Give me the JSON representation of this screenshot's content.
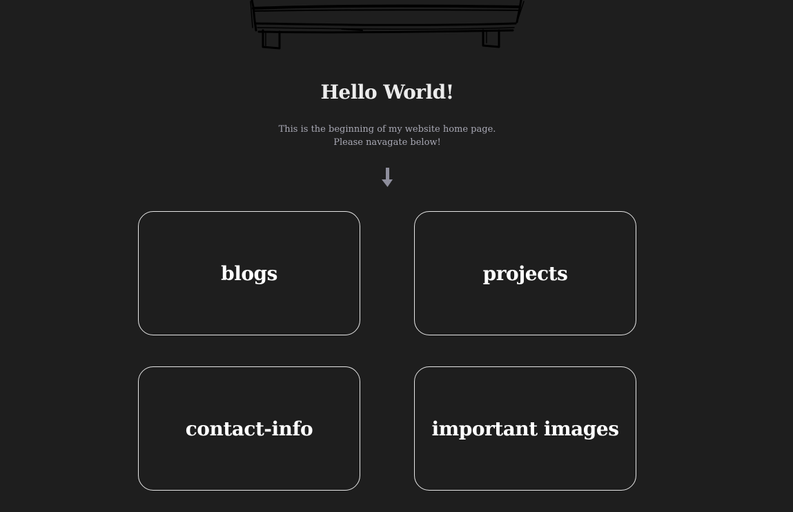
{
  "header": {
    "title": "Hello World!",
    "intro_line_1": "This is the beginning of my website home page.",
    "intro_line_2": "Please navagate below!"
  },
  "icons": {
    "hero": "hand-drawn-bed-sketch",
    "scroll": "down-arrow-icon"
  },
  "nav_cards": [
    {
      "label": "blogs"
    },
    {
      "label": "projects"
    },
    {
      "label": "contact-info"
    },
    {
      "label": "important images"
    }
  ],
  "colors": {
    "background": "#1e1e1e",
    "text": "#ececec",
    "muted_text": "#a8a8b4",
    "card_border": "#e6e6e6"
  }
}
